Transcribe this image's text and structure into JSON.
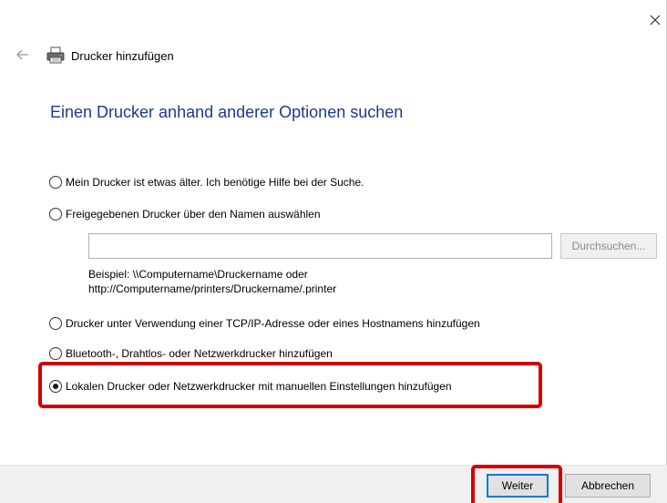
{
  "window": {
    "title": "Drucker hinzufügen",
    "instruction": "Einen Drucker anhand anderer Optionen suchen"
  },
  "icons": {
    "close": "close-icon",
    "back": "back-arrow-icon",
    "printer": "printer-icon"
  },
  "options": [
    {
      "label": "Mein Drucker ist etwas älter. Ich benötige Hilfe bei der Suche.",
      "checked": false
    },
    {
      "label": "Freigegebenen Drucker über den Namen auswählen",
      "checked": false
    },
    {
      "label": "Drucker unter Verwendung einer TCP/IP-Adresse oder eines Hostnamens hinzufügen",
      "checked": false
    },
    {
      "label": "Bluetooth-, Drahtlos- oder Netzwerkdrucker hinzufügen",
      "checked": false
    },
    {
      "label": "Lokalen Drucker oder Netzwerkdrucker mit manuellen Einstellungen hinzufügen",
      "checked": true
    }
  ],
  "shared_printer": {
    "input_value": "",
    "browse_label": "Durchsuchen...",
    "example_line1": "Beispiel: \\\\Computername\\Druckername oder",
    "example_line2": "http://Computername/printers/Druckername/.printer"
  },
  "footer": {
    "next_label": "Weiter",
    "cancel_label": "Abbrechen"
  },
  "colors": {
    "instruction": "#1e3a8a",
    "highlight": "#d00000",
    "default_button_border": "#0078d7"
  }
}
